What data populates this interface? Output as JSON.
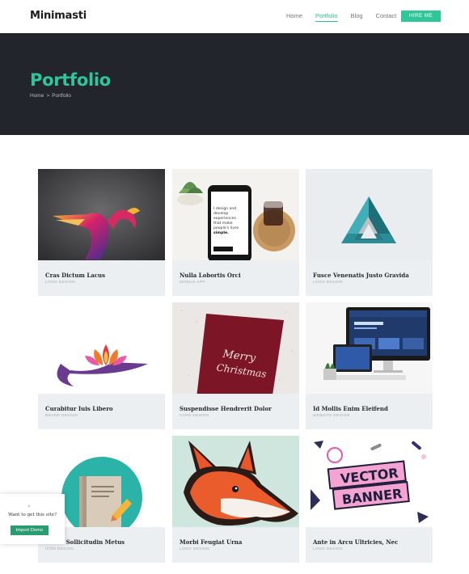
{
  "header": {
    "logo": "Minimasti",
    "nav": [
      "Home",
      "Portfolio",
      "Blog",
      "Contact"
    ],
    "hire_label": "HIRE ME"
  },
  "hero": {
    "title": "Portfolio",
    "breadcrumb": [
      "Home",
      ">",
      "Portfolio"
    ]
  },
  "projects": [
    {
      "title": "Cras Dictum Lacus",
      "category": "LOGO DESIGN"
    },
    {
      "title": "Nulla Lobortis Orci",
      "category": "MOBILE APP"
    },
    {
      "title": "Fusce Venenatis Justo Gravida",
      "category": "LOGO DESIGN"
    },
    {
      "title": "Curabitur Iuis Libero",
      "category": "BRAND DESIGN"
    },
    {
      "title": "Suspendisse Hendrerit Dolor",
      "category": "CARD DESIGN"
    },
    {
      "title": "Id Mollis Enim Eleifend",
      "category": "WEBSITE DESIGN"
    },
    {
      "title": "Etiam Sollicitudin Metus",
      "category": "ICON DESIGN"
    },
    {
      "title": "Morbi Feugiat Urna",
      "category": "LOGO DESIGN"
    },
    {
      "title": "Ante in Arcu Ultricies, Nec",
      "category": "LOGO DESIGN"
    }
  ],
  "artwork_text": {
    "phone_lines": [
      "I design and",
      "develop",
      "experiences",
      "that make",
      "people's lives",
      "simple."
    ],
    "card_text": [
      "Merry",
      "Christmas"
    ],
    "banner_text": [
      "VECTOR",
      "BANNER"
    ]
  },
  "popup": {
    "close": "×",
    "question": "Want to get this site?",
    "button": "Import Demo"
  },
  "colors": {
    "accent": "#2fc79a",
    "hero_bg": "#22252b"
  }
}
